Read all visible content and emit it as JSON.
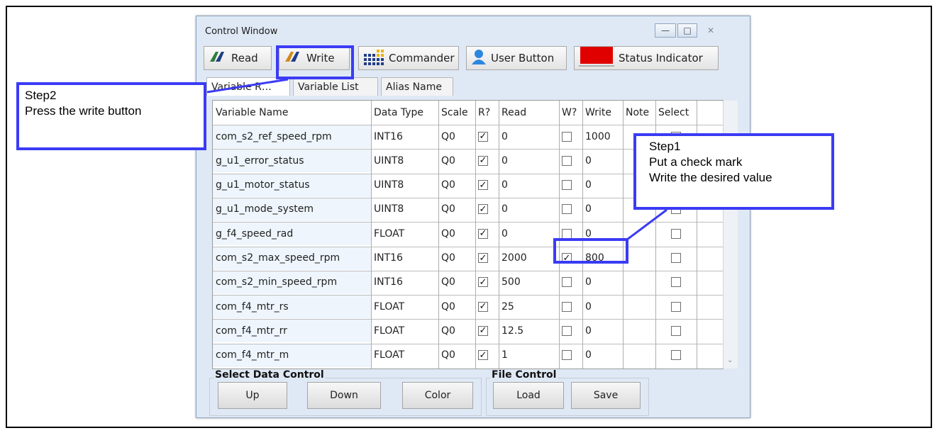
{
  "window": {
    "title": "Control Window",
    "controls": [
      "minimize",
      "restore",
      "close"
    ]
  },
  "toolbar": [
    {
      "label": "Read",
      "icon": "read-icon"
    },
    {
      "label": "Write",
      "icon": "write-icon"
    },
    {
      "label": "Commander",
      "icon": "commander-icon"
    },
    {
      "label": "User Button",
      "icon": "user-icon"
    },
    {
      "label": "Status Indicator",
      "icon": "status-indicator-icon",
      "color": "#e00000"
    }
  ],
  "subtabs": [
    "Variable R…",
    "Variable List",
    "Alias Name"
  ],
  "table": {
    "headers": [
      "Variable Name",
      "Data Type",
      "Scale",
      "R?",
      "Read",
      "W?",
      "Write",
      "Note",
      "Select"
    ],
    "rows": [
      {
        "name": "com_s2_ref_speed_rpm",
        "type": "INT16",
        "scale": "Q0",
        "r": true,
        "read": "0",
        "w": false,
        "write": "1000",
        "note": "",
        "select": false
      },
      {
        "name": "g_u1_error_status",
        "type": "UINT8",
        "scale": "Q0",
        "r": true,
        "read": "0",
        "w": false,
        "write": "0",
        "note": "",
        "select": false
      },
      {
        "name": "g_u1_motor_status",
        "type": "UINT8",
        "scale": "Q0",
        "r": true,
        "read": "0",
        "w": false,
        "write": "0",
        "note": "",
        "select": false
      },
      {
        "name": "g_u1_mode_system",
        "type": "UINT8",
        "scale": "Q0",
        "r": true,
        "read": "0",
        "w": false,
        "write": "0",
        "note": "",
        "select": false
      },
      {
        "name": "g_f4_speed_rad",
        "type": "FLOAT",
        "scale": "Q0",
        "r": true,
        "read": "0",
        "w": false,
        "write": "0",
        "note": "",
        "select": false
      },
      {
        "name": "com_s2_max_speed_rpm",
        "type": "INT16",
        "scale": "Q0",
        "r": true,
        "read": "2000",
        "w": true,
        "write": "800",
        "note": "",
        "select": false
      },
      {
        "name": "com_s2_min_speed_rpm",
        "type": "INT16",
        "scale": "Q0",
        "r": true,
        "read": "500",
        "w": false,
        "write": "0",
        "note": "",
        "select": false
      },
      {
        "name": "com_f4_mtr_rs",
        "type": "FLOAT",
        "scale": "Q0",
        "r": true,
        "read": "25",
        "w": false,
        "write": "0",
        "note": "",
        "select": false
      },
      {
        "name": "com_f4_mtr_rr",
        "type": "FLOAT",
        "scale": "Q0",
        "r": true,
        "read": "12.5",
        "w": false,
        "write": "0",
        "note": "",
        "select": false
      },
      {
        "name": "com_f4_mtr_m",
        "type": "FLOAT",
        "scale": "Q0",
        "r": true,
        "read": "1",
        "w": false,
        "write": "0",
        "note": "",
        "select": false
      }
    ]
  },
  "select_data_control": {
    "label": "Select Data Control",
    "buttons": [
      "Up",
      "Down",
      "Color"
    ]
  },
  "file_control": {
    "label": "File Control",
    "buttons": [
      "Load",
      "Save"
    ]
  },
  "callouts": {
    "step2": {
      "title": "Step2",
      "text": "Press the write button"
    },
    "step1": {
      "title": "Step1",
      "line1": "Put a check mark",
      "line2": "Write the desired value"
    }
  },
  "colors": {
    "highlight": "#3b3bf5",
    "window_bg": "#dfe9f5"
  }
}
